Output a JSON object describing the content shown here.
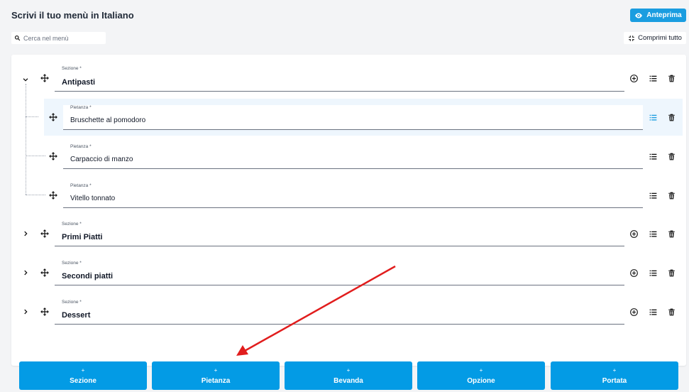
{
  "header": {
    "title": "Scrivi il tuo menù in Italiano",
    "preview_label": "Anteprima"
  },
  "search": {
    "placeholder": "Cerca nel menù"
  },
  "collapse_all_label": "Comprimi tutto",
  "menu": {
    "section_label": "Sezione *",
    "dish_label": "Pietanza *",
    "sections": [
      {
        "name": "Antipasti",
        "expanded": true,
        "items": [
          "Bruschette al pomodoro",
          "Carpaccio di manzo",
          "Vitello tonnato"
        ]
      },
      {
        "name": "Primi Piatti",
        "expanded": false
      },
      {
        "name": "Secondi piatti",
        "expanded": false
      },
      {
        "name": "Dessert",
        "expanded": false
      }
    ]
  },
  "add_buttons": {
    "plus": "+",
    "items": [
      "Sezione",
      "Pietanza",
      "Bevanda",
      "Opzione",
      "Portata"
    ]
  },
  "colors": {
    "primary": "#039be5",
    "highlight_row": "#eef6fd",
    "annotation_arrow": "#e11d1d"
  }
}
